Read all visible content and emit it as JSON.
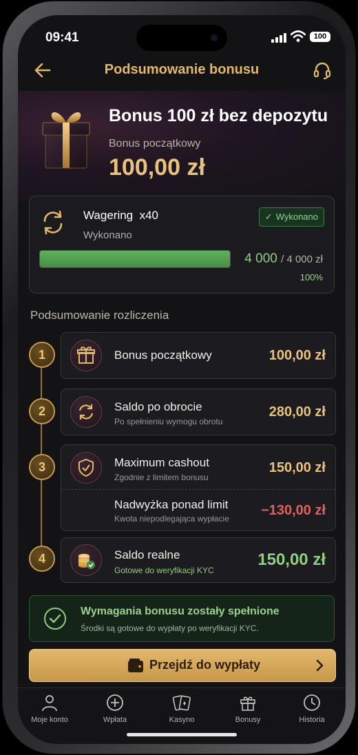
{
  "status": {
    "time": "09:41",
    "battery": "100"
  },
  "header": {
    "title": "Podsumowanie bonusu"
  },
  "hero": {
    "title": "Bonus 100 zł bez depozytu",
    "subtitle": "Bonus początkowy",
    "amount": "100,00 zł"
  },
  "wagering": {
    "title": "Wagering  x40",
    "status": "Wykonano",
    "badge": "Wykonano",
    "progress_current": "4 000",
    "progress_total": "/ 4 000 zł",
    "progress_percent": "100%",
    "progress_fraction": 1.0
  },
  "summary": {
    "title": "Podsumowanie rozliczenia",
    "steps": [
      {
        "num": "1",
        "title": "Bonus początkowy",
        "sub": "",
        "value": "100,00 zł",
        "icon": "gift-icon"
      },
      {
        "num": "2",
        "title": "Saldo po obrocie",
        "sub": "Po spełnieniu wymogu obrotu",
        "value": "280,00 zł",
        "icon": "refresh-icon"
      },
      {
        "num": "3",
        "title": "Maximum cashout",
        "sub": "Zgodnie z limitem bonusu",
        "value": "150,00 zł",
        "icon": "shield-check-icon",
        "extra_title": "Nadwyżka ponad limit",
        "extra_sub": "Kwota niepodlegająca wypłacie",
        "extra_value": "−130,00 zł"
      },
      {
        "num": "4",
        "title": "Saldo realne",
        "sub": "Gotowe do weryfikacji KYC",
        "value": "150,00 zł",
        "icon": "coins-check-icon"
      }
    ]
  },
  "success": {
    "title": "Wymagania bonusu zostały spełnione",
    "sub": "Środki są gotowe do wypłaty po weryfikacji KYC."
  },
  "cta": {
    "label": "Przejdź do wypłaty"
  },
  "tabs": [
    {
      "label": "Moje konto",
      "icon": "user-icon"
    },
    {
      "label": "Wpłata",
      "icon": "plus-circle-icon"
    },
    {
      "label": "Kasyno",
      "icon": "cards-icon"
    },
    {
      "label": "Bonusy",
      "icon": "gift-icon"
    },
    {
      "label": "Historia",
      "icon": "clock-icon"
    }
  ],
  "colors": {
    "gold": "#e8c37c",
    "green": "#8fcf7f",
    "red": "#e0615a"
  }
}
